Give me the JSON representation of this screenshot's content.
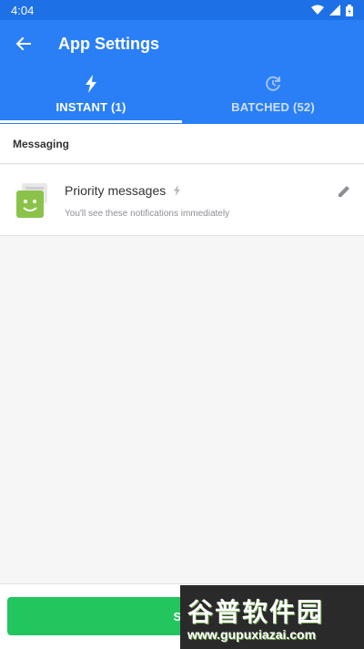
{
  "status_bar": {
    "time": "4:04",
    "icons": [
      "wifi-icon",
      "signal-icon",
      "battery-icon"
    ]
  },
  "app_bar": {
    "title": "App Settings",
    "back_icon": "arrow-left-icon"
  },
  "tabs": [
    {
      "label": "INSTANT (1)",
      "icon": "bolt-icon",
      "active": true
    },
    {
      "label": "BATCHED (52)",
      "icon": "clock-refresh-icon",
      "active": false
    }
  ],
  "section": {
    "title": "Messaging"
  },
  "card": {
    "title": "Priority messages",
    "subtitle": "You'll see these notifications immediately",
    "icon": "messaging-app-icon",
    "badge_icon": "bolt-icon",
    "edit_icon": "pencil-icon"
  },
  "footer": {
    "save_label": "SA"
  },
  "watermark": {
    "title": "谷普软件园",
    "url": "www.gupuxiazai.com"
  },
  "colors": {
    "primary": "#2a7ff7",
    "status": "#1e70e6",
    "save": "#22c55e"
  }
}
